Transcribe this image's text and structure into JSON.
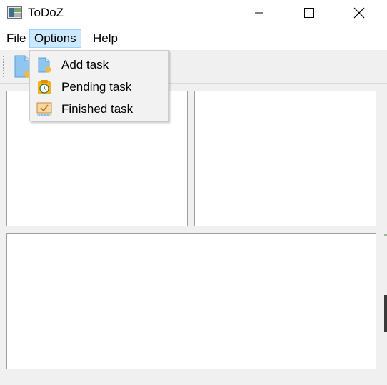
{
  "window": {
    "title": "ToDoZ",
    "icons": {
      "app": "app-window-icon",
      "minimize": "minimize-icon",
      "maximize": "maximize-icon",
      "close": "close-icon"
    }
  },
  "menubar": {
    "items": [
      {
        "label": "File"
      },
      {
        "label": "Options",
        "active": true
      },
      {
        "label": "Help"
      }
    ]
  },
  "toolbar": {
    "buttons": [
      {
        "icon": "add-task-icon"
      }
    ]
  },
  "options_menu": {
    "items": [
      {
        "label": "Add task",
        "icon": "add-task-icon"
      },
      {
        "label": "Pending task",
        "icon": "pending-clock-icon"
      },
      {
        "label": "Finished task",
        "icon": "finished-check-icon"
      }
    ]
  },
  "colors": {
    "menu_highlight": "#cce8ff",
    "menu_highlight_border": "#99d1ff",
    "window_bg": "#f0f0f0",
    "panel_bg": "#ffffff"
  }
}
